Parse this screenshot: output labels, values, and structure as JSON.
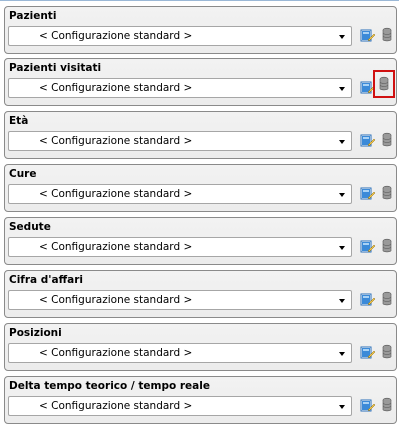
{
  "panels": [
    {
      "title": "Pazienti",
      "value": "< Configurazione standard >"
    },
    {
      "title": "Pazienti visitati",
      "value": "< Configurazione standard >"
    },
    {
      "title": "Età",
      "value": "< Configurazione standard >"
    },
    {
      "title": "Cure",
      "value": "< Configurazione standard >"
    },
    {
      "title": "Sedute",
      "value": "< Configurazione standard >"
    },
    {
      "title": "Cifra d'affari",
      "value": "< Configurazione standard >"
    },
    {
      "title": "Posizioni",
      "value": "< Configurazione standard >"
    },
    {
      "title": "Delta tempo teorico / tempo reale",
      "value": "< Configurazione standard >"
    }
  ],
  "icons": {
    "edit": "edit-config-icon",
    "database": "database-icon"
  },
  "highlight": {
    "panel_index": 1,
    "color": "#d01010"
  }
}
